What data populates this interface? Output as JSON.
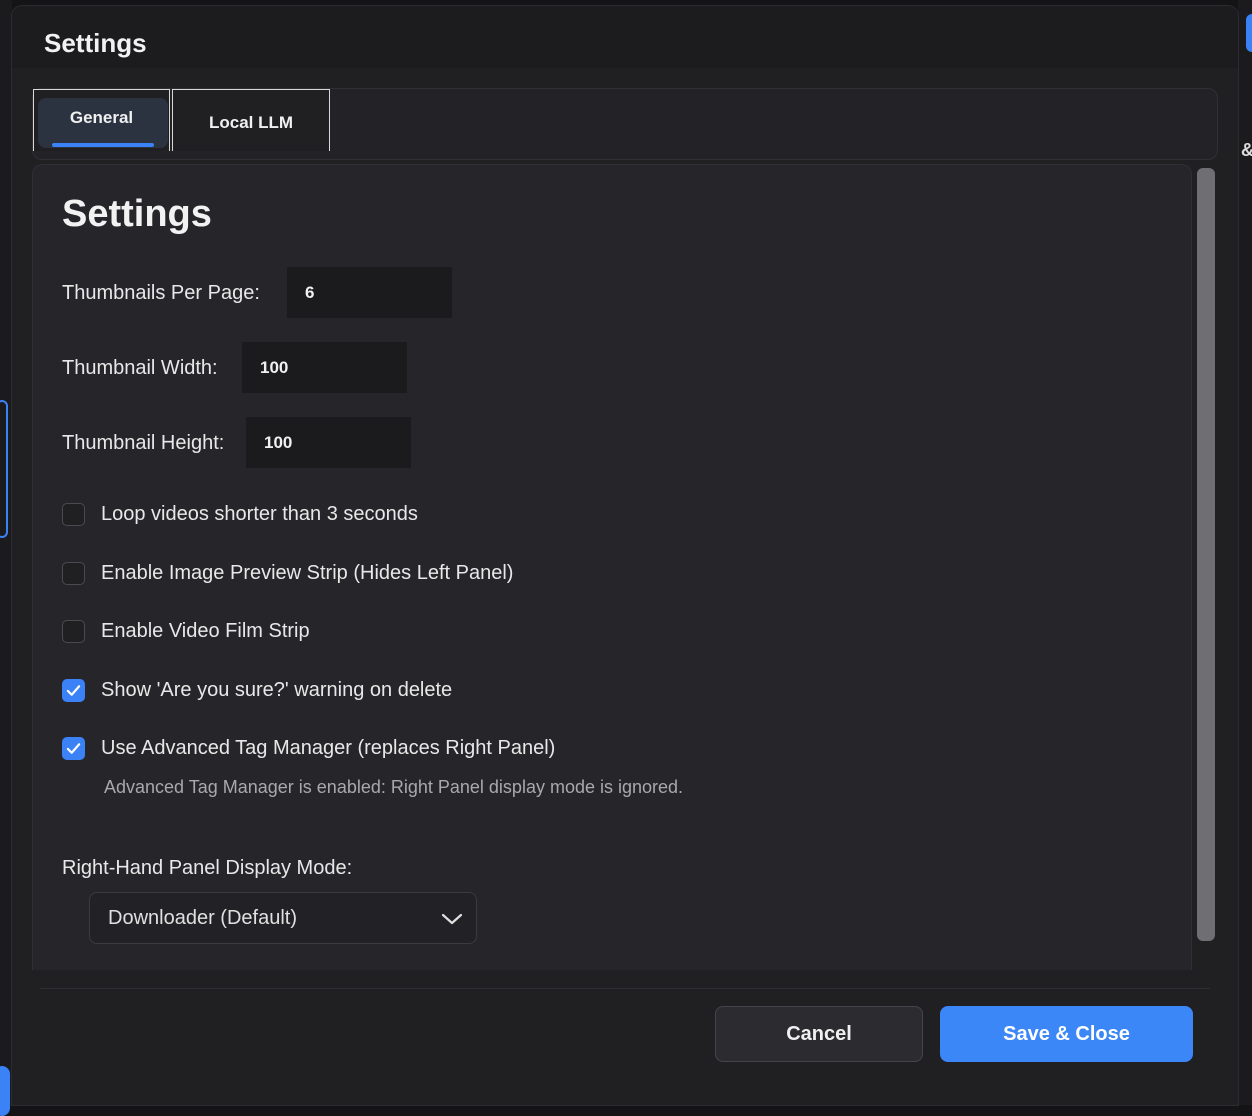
{
  "dialog": {
    "title": "Settings"
  },
  "tabs": [
    {
      "label": "General",
      "active": true
    },
    {
      "label": "Local LLM",
      "active": false
    }
  ],
  "general": {
    "section_title": "Settings",
    "fields": [
      {
        "label": "Thumbnails Per Page:",
        "value": "6"
      },
      {
        "label": "Thumbnail Width:",
        "value": "100"
      },
      {
        "label": "Thumbnail Height:",
        "value": "100"
      }
    ],
    "checkboxes": [
      {
        "label": "Loop videos shorter than 3 seconds",
        "checked": false
      },
      {
        "label": "Enable Image Preview Strip (Hides Left Panel)",
        "checked": false
      },
      {
        "label": "Enable Video Film Strip",
        "checked": false
      },
      {
        "label": "Show 'Are you sure?' warning on delete",
        "checked": true
      },
      {
        "label": "Use Advanced Tag Manager (replaces Right Panel)",
        "checked": true
      }
    ],
    "hint": "Advanced Tag Manager is enabled: Right Panel display mode is ignored.",
    "display_mode": {
      "label": "Right-Hand Panel Display Mode:",
      "selected": "Downloader (Default)"
    }
  },
  "footer": {
    "cancel_label": "Cancel",
    "save_label": "Save & Close"
  },
  "background": {
    "edge_glyph": "&"
  },
  "colors": {
    "accent": "#3b82f6",
    "dialog_bg": "#202023",
    "panel_bg": "#26262a"
  }
}
